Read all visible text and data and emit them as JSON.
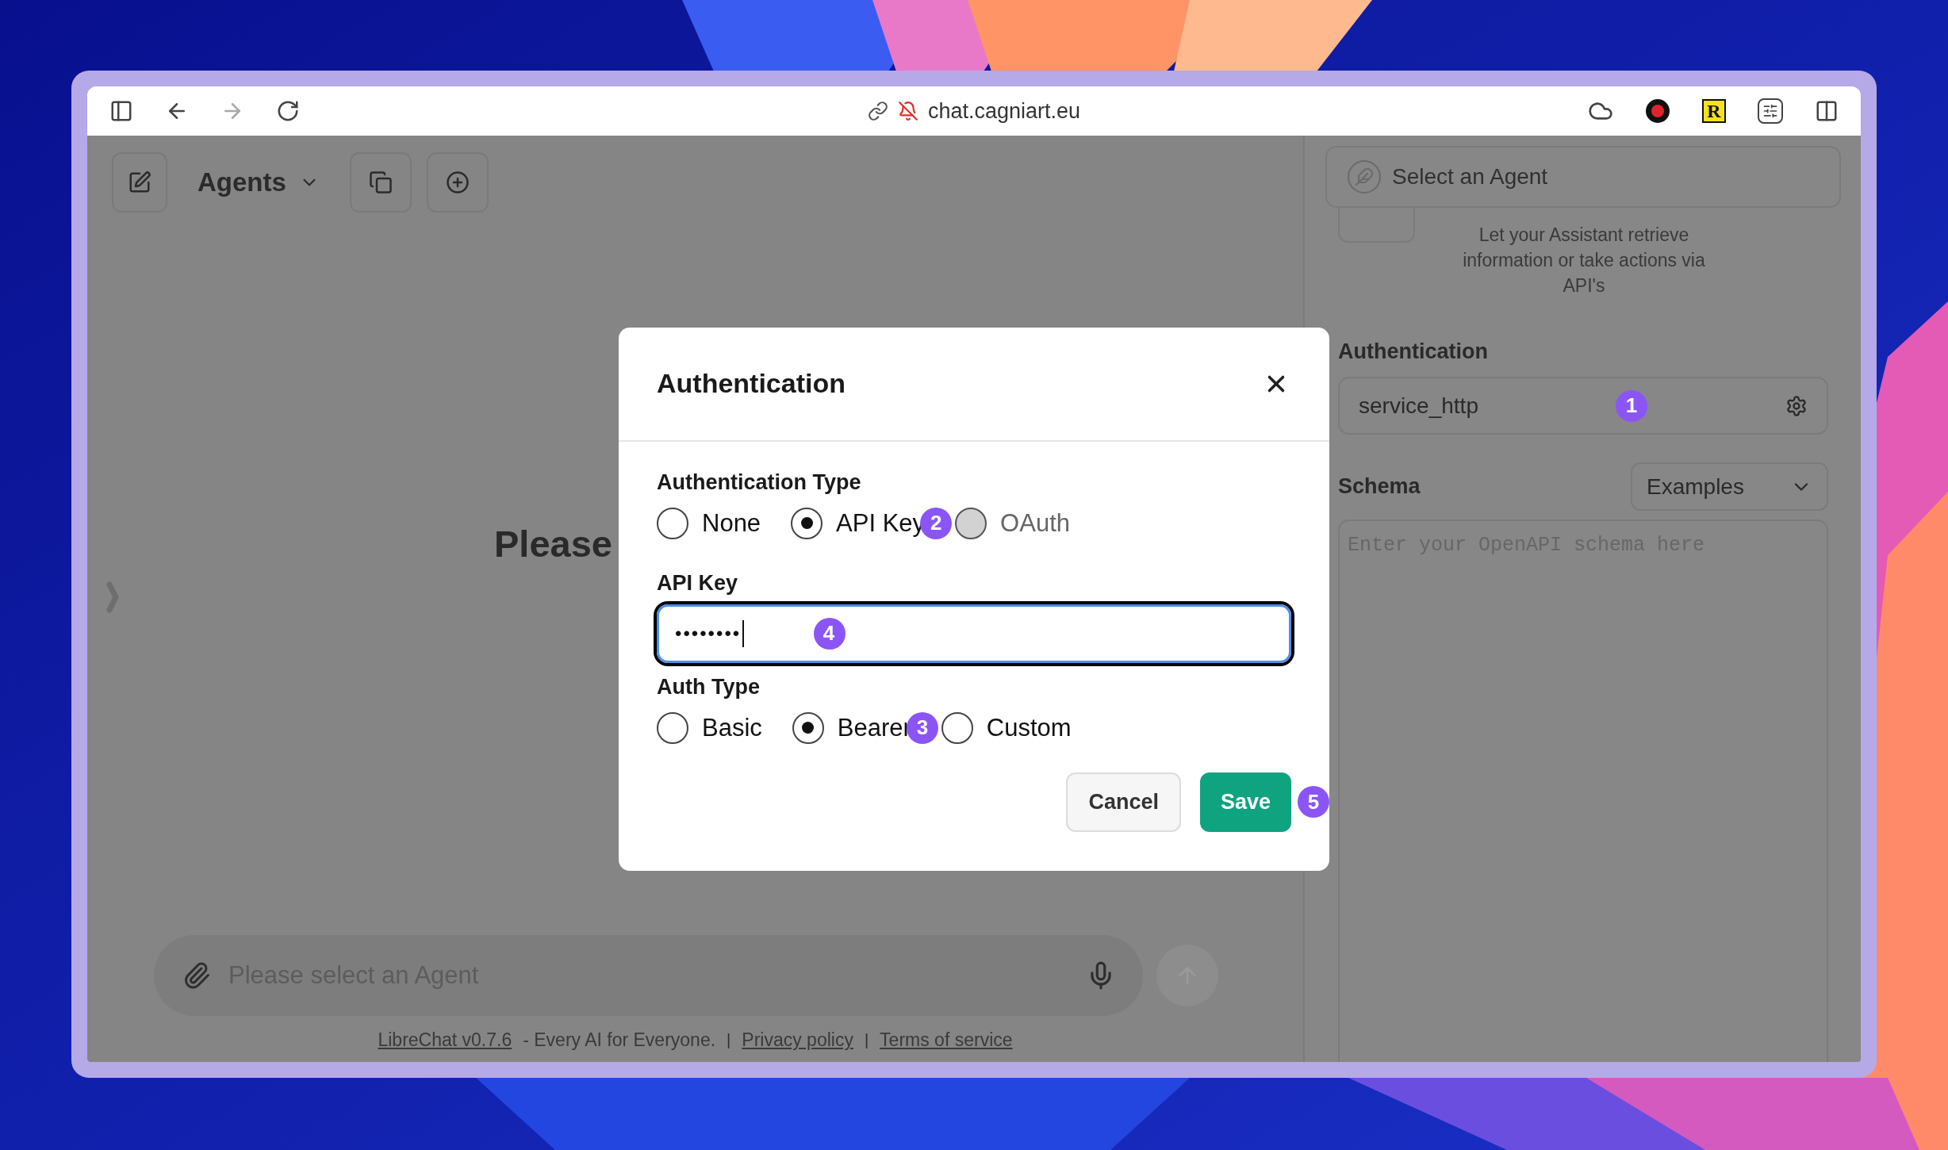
{
  "browser": {
    "url": "chat.cagniart.eu",
    "extensions": [
      {
        "kind": "cloud"
      },
      {
        "kind": "record"
      },
      {
        "kind": "letter",
        "text": "R"
      },
      {
        "kind": "sliders"
      }
    ]
  },
  "toolbar": {
    "title": "Agents"
  },
  "main": {
    "heading": "Please",
    "input_placeholder": "Please select an Agent"
  },
  "footer": [
    {
      "kind": "link",
      "text": "LibreChat v0.7.6"
    },
    {
      "kind": "text",
      "text": "- Every AI for Everyone."
    },
    {
      "kind": "divider",
      "text": "|"
    },
    {
      "kind": "link",
      "text": "Privacy policy"
    },
    {
      "kind": "divider",
      "text": "|"
    },
    {
      "kind": "link",
      "text": "Terms of service"
    }
  ],
  "panel": {
    "agent_select": "Select an Agent",
    "description": "Let your Assistant retrieve information or take actions via API's",
    "auth_label": "Authentication",
    "auth_value": "service_http",
    "auth_badge": "1",
    "schema_label": "Schema",
    "examples": "Examples",
    "schema_placeholder": "Enter your OpenAPI schema here"
  },
  "dialog": {
    "title": "Authentication",
    "sections": [
      {
        "kind": "radio",
        "label": "Authentication Type",
        "options": [
          {
            "label": "None",
            "selected": false,
            "disabled": false
          },
          {
            "label": "API Key",
            "selected": true,
            "disabled": false,
            "badge": "2"
          },
          {
            "label": "OAuth",
            "selected": false,
            "disabled": true
          }
        ]
      },
      {
        "kind": "input",
        "label": "API Key",
        "value": "••••••••",
        "focused": true,
        "badge": "4"
      },
      {
        "kind": "radio",
        "label": "Auth Type",
        "options": [
          {
            "label": "Basic",
            "selected": false,
            "disabled": false
          },
          {
            "label": "Bearer",
            "selected": true,
            "disabled": false,
            "badge": "3"
          },
          {
            "label": "Custom",
            "selected": false,
            "disabled": false
          }
        ]
      }
    ],
    "buttons": [
      {
        "kind": "secondary",
        "label": "Cancel"
      },
      {
        "kind": "primary",
        "label": "Save",
        "badge": "5"
      }
    ]
  }
}
